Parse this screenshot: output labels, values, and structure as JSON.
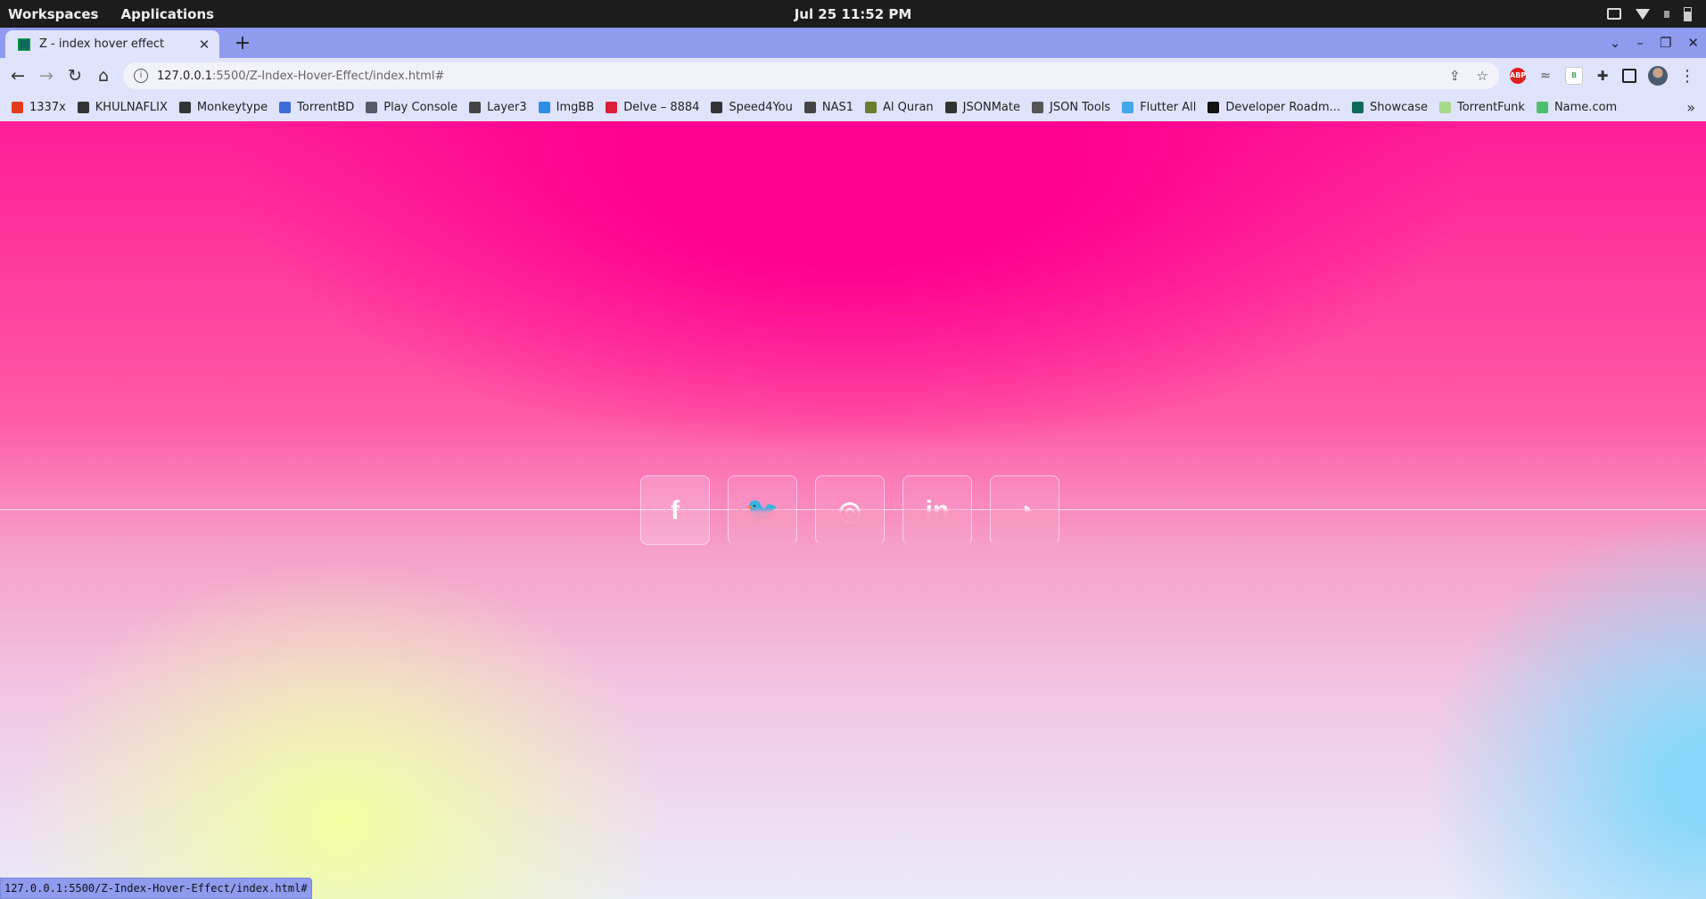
{
  "system_bar": {
    "workspaces": "Workspaces",
    "applications": "Applications",
    "clock": "Jul 25  11:52 PM",
    "tray_icons": [
      "display-icon",
      "wifi-icon",
      "volume-icon",
      "battery-icon"
    ]
  },
  "browser": {
    "tab": {
      "title": "Z - index hover effect",
      "close": "✕"
    },
    "new_tab": "+",
    "window_controls": {
      "dropdown": "⌄",
      "minimize": "–",
      "restore": "❐",
      "close": "✕"
    },
    "nav": {
      "back": "←",
      "forward": "→",
      "reload": "↻",
      "home": "⌂"
    },
    "address": {
      "host": "127.0.0.1",
      "port_path": ":5500/Z-Index-Hover-Effect/index.html#"
    },
    "omnibox_actions": {
      "share": "⇪",
      "bookmark": "☆"
    },
    "extensions": {
      "abp": "ABP",
      "wave": "≈",
      "b": "B",
      "puzzle": "✚",
      "menu": "⋮"
    },
    "bookmarks": [
      {
        "label": "1337x",
        "color": "#e33b1e"
      },
      {
        "label": "KHULNAFLIX",
        "color": "#333333"
      },
      {
        "label": "Monkeytype",
        "color": "#323437"
      },
      {
        "label": "TorrentBD",
        "color": "#3b6bd6"
      },
      {
        "label": "Play Console",
        "color": "#555a66"
      },
      {
        "label": "Layer3",
        "color": "#444444"
      },
      {
        "label": "ImgBB",
        "color": "#2a8ee6"
      },
      {
        "label": "Delve – 8884",
        "color": "#d91e36"
      },
      {
        "label": "Speed4You",
        "color": "#333333"
      },
      {
        "label": "NAS1",
        "color": "#444444"
      },
      {
        "label": "Al Quran",
        "color": "#6a7d2c"
      },
      {
        "label": "JSONMate",
        "color": "#333333"
      },
      {
        "label": "JSON Tools",
        "color": "#555555"
      },
      {
        "label": "Flutter All",
        "color": "#41a8e8"
      },
      {
        "label": "Developer Roadm...",
        "color": "#111111"
      },
      {
        "label": "Showcase",
        "color": "#0f6b5a"
      },
      {
        "label": "TorrentFunk",
        "color": "#a7d98a"
      },
      {
        "label": "Name.com",
        "color": "#4cbf6a"
      }
    ],
    "bookmarks_more": "»",
    "status_url": "127.0.0.1:5500/Z-Index-Hover-Effect/index.html#"
  },
  "page": {
    "social_icons": [
      {
        "name": "facebook-icon",
        "glyph": "f",
        "state": "hovered"
      },
      {
        "name": "twitter-icon",
        "glyph": "🐦",
        "state": "sunk"
      },
      {
        "name": "instagram-icon",
        "glyph": "◎",
        "state": "sunk"
      },
      {
        "name": "linkedin-icon",
        "glyph": "in",
        "state": "sunk"
      },
      {
        "name": "whatsapp-icon",
        "glyph": "◔",
        "state": "sunk"
      }
    ]
  }
}
